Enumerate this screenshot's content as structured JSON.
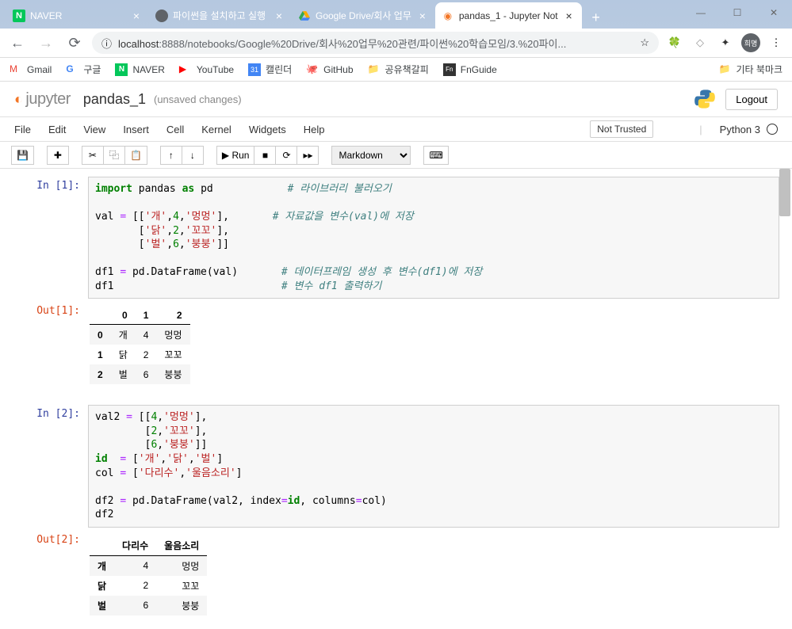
{
  "window": {
    "minimize": "—",
    "maximize": "☐",
    "close": "✕"
  },
  "tabs": [
    {
      "title": "NAVER",
      "icon": "naver",
      "active": false
    },
    {
      "title": "파이썬을 설치하고 실행",
      "icon": "globe",
      "active": false
    },
    {
      "title": "Google Drive/회사 업무",
      "icon": "drive",
      "active": false
    },
    {
      "title": "pandas_1 - Jupyter Not",
      "icon": "jupyter",
      "active": true
    }
  ],
  "new_tab": "+",
  "nav": {
    "back": "←",
    "forward": "→",
    "reload": "⟳"
  },
  "url": {
    "info_icon": "ⓘ",
    "host": "localhost",
    "port": ":8888",
    "path": "/notebooks/Google%20Drive/회사%20업무%20관련/파이썬%20학습모임/3.%20파이...",
    "star": "☆"
  },
  "extensions": {
    "evernote": "🐘",
    "shield": "🛡",
    "puzzle": "✱",
    "avatar": "희명",
    "menu": "⋮"
  },
  "bookmarks": [
    {
      "icon": "M",
      "label": "Gmail",
      "color": "#ea4335"
    },
    {
      "icon": "G",
      "label": "구글",
      "color": "#4285f4"
    },
    {
      "icon": "N",
      "label": "NAVER",
      "color": "#03c75a"
    },
    {
      "icon": "▶",
      "label": "YouTube",
      "color": "#ff0000"
    },
    {
      "icon": "📅",
      "label": "캘린더",
      "color": "#4285f4"
    },
    {
      "icon": "🐙",
      "label": "GitHub",
      "color": "#333"
    },
    {
      "icon": "📁",
      "label": "공유책갈피",
      "color": "#f9ab00"
    },
    {
      "icon": "Fn",
      "label": "FnGuide",
      "color": "#333"
    }
  ],
  "other_bookmarks": {
    "icon": "📁",
    "label": "기타 북마크"
  },
  "jupyter": {
    "brand": "jupyter",
    "notebook_name": "pandas_1",
    "save_status": "(unsaved changes)",
    "logout": "Logout",
    "menu": [
      "File",
      "Edit",
      "View",
      "Insert",
      "Cell",
      "Kernel",
      "Widgets",
      "Help"
    ],
    "trust": "Not Trusted",
    "kernel": "Python 3",
    "toolbar": {
      "save": "💾",
      "add": "✚",
      "cut": "✂",
      "copy": "⿻",
      "paste": "📋",
      "up": "↑",
      "down": "↓",
      "run": "▶ Run",
      "stop": "■",
      "restart": "⟳",
      "forward": "▸▸",
      "cell_type": "Markdown",
      "keyboard": "⌨"
    }
  },
  "cells": [
    {
      "in_prompt": "In [1]:",
      "out_prompt": "Out[1]:",
      "code_tokens": [
        [
          {
            "t": "kw",
            "v": "import"
          },
          {
            "t": "id",
            "v": " pandas "
          },
          {
            "t": "kw",
            "v": "as"
          },
          {
            "t": "id",
            "v": " pd            "
          },
          {
            "t": "cmt",
            "v": "# 라이브러리 불러오기"
          }
        ],
        [],
        [
          {
            "t": "id",
            "v": "val "
          },
          {
            "t": "op",
            "v": "="
          },
          {
            "t": "id",
            "v": " [["
          },
          {
            "t": "str",
            "v": "'개'"
          },
          {
            "t": "id",
            "v": ","
          },
          {
            "t": "num",
            "v": "4"
          },
          {
            "t": "id",
            "v": ","
          },
          {
            "t": "str",
            "v": "'멍멍'"
          },
          {
            "t": "id",
            "v": "],       "
          },
          {
            "t": "cmt",
            "v": "# 자료값을 변수(val)에 저장"
          }
        ],
        [
          {
            "t": "id",
            "v": "       ["
          },
          {
            "t": "str",
            "v": "'닭'"
          },
          {
            "t": "id",
            "v": ","
          },
          {
            "t": "num",
            "v": "2"
          },
          {
            "t": "id",
            "v": ","
          },
          {
            "t": "str",
            "v": "'꼬꼬'"
          },
          {
            "t": "id",
            "v": "],"
          }
        ],
        [
          {
            "t": "id",
            "v": "       ["
          },
          {
            "t": "str",
            "v": "'벌'"
          },
          {
            "t": "id",
            "v": ","
          },
          {
            "t": "num",
            "v": "6"
          },
          {
            "t": "id",
            "v": ","
          },
          {
            "t": "str",
            "v": "'붕붕'"
          },
          {
            "t": "id",
            "v": "]]"
          }
        ],
        [],
        [
          {
            "t": "id",
            "v": "df1 "
          },
          {
            "t": "op",
            "v": "="
          },
          {
            "t": "id",
            "v": " pd.DataFrame(val)       "
          },
          {
            "t": "cmt",
            "v": "# 데이터프레임 생성 후 변수(df1)에 저장"
          }
        ],
        [
          {
            "t": "id",
            "v": "df1                           "
          },
          {
            "t": "cmt",
            "v": "# 변수 df1 출력하기"
          }
        ]
      ],
      "output": {
        "headers": [
          "",
          "0",
          "1",
          "2"
        ],
        "rows": [
          [
            "0",
            "개",
            "4",
            "멍멍"
          ],
          [
            "1",
            "닭",
            "2",
            "꼬꼬"
          ],
          [
            "2",
            "벌",
            "6",
            "붕붕"
          ]
        ]
      }
    },
    {
      "in_prompt": "In [2]:",
      "out_prompt": "Out[2]:",
      "code_tokens": [
        [
          {
            "t": "id",
            "v": "val2 "
          },
          {
            "t": "op",
            "v": "="
          },
          {
            "t": "id",
            "v": " [["
          },
          {
            "t": "num",
            "v": "4"
          },
          {
            "t": "id",
            "v": ","
          },
          {
            "t": "str",
            "v": "'멍멍'"
          },
          {
            "t": "id",
            "v": "],"
          }
        ],
        [
          {
            "t": "id",
            "v": "        ["
          },
          {
            "t": "num",
            "v": "2"
          },
          {
            "t": "id",
            "v": ","
          },
          {
            "t": "str",
            "v": "'꼬꼬'"
          },
          {
            "t": "id",
            "v": "],"
          }
        ],
        [
          {
            "t": "id",
            "v": "        ["
          },
          {
            "t": "num",
            "v": "6"
          },
          {
            "t": "id",
            "v": ","
          },
          {
            "t": "str",
            "v": "'붕붕'"
          },
          {
            "t": "id",
            "v": "]]"
          }
        ],
        [
          {
            "t": "kw",
            "v": "id"
          },
          {
            "t": "id",
            "v": "  "
          },
          {
            "t": "op",
            "v": "="
          },
          {
            "t": "id",
            "v": " ["
          },
          {
            "t": "str",
            "v": "'개'"
          },
          {
            "t": "id",
            "v": ","
          },
          {
            "t": "str",
            "v": "'닭'"
          },
          {
            "t": "id",
            "v": ","
          },
          {
            "t": "str",
            "v": "'벌'"
          },
          {
            "t": "id",
            "v": "]"
          }
        ],
        [
          {
            "t": "id",
            "v": "col "
          },
          {
            "t": "op",
            "v": "="
          },
          {
            "t": "id",
            "v": " ["
          },
          {
            "t": "str",
            "v": "'다리수'"
          },
          {
            "t": "id",
            "v": ","
          },
          {
            "t": "str",
            "v": "'울음소리'"
          },
          {
            "t": "id",
            "v": "]"
          }
        ],
        [],
        [
          {
            "t": "id",
            "v": "df2 "
          },
          {
            "t": "op",
            "v": "="
          },
          {
            "t": "id",
            "v": " pd.DataFrame(val2, index"
          },
          {
            "t": "op",
            "v": "="
          },
          {
            "t": "kw",
            "v": "id"
          },
          {
            "t": "id",
            "v": ", columns"
          },
          {
            "t": "op",
            "v": "="
          },
          {
            "t": "id",
            "v": "col)"
          }
        ],
        [
          {
            "t": "id",
            "v": "df2"
          }
        ]
      ],
      "output": {
        "headers": [
          "",
          "다리수",
          "울음소리"
        ],
        "rows": [
          [
            "개",
            "4",
            "멍멍"
          ],
          [
            "닭",
            "2",
            "꼬꼬"
          ],
          [
            "벌",
            "6",
            "붕붕"
          ]
        ]
      }
    }
  ]
}
